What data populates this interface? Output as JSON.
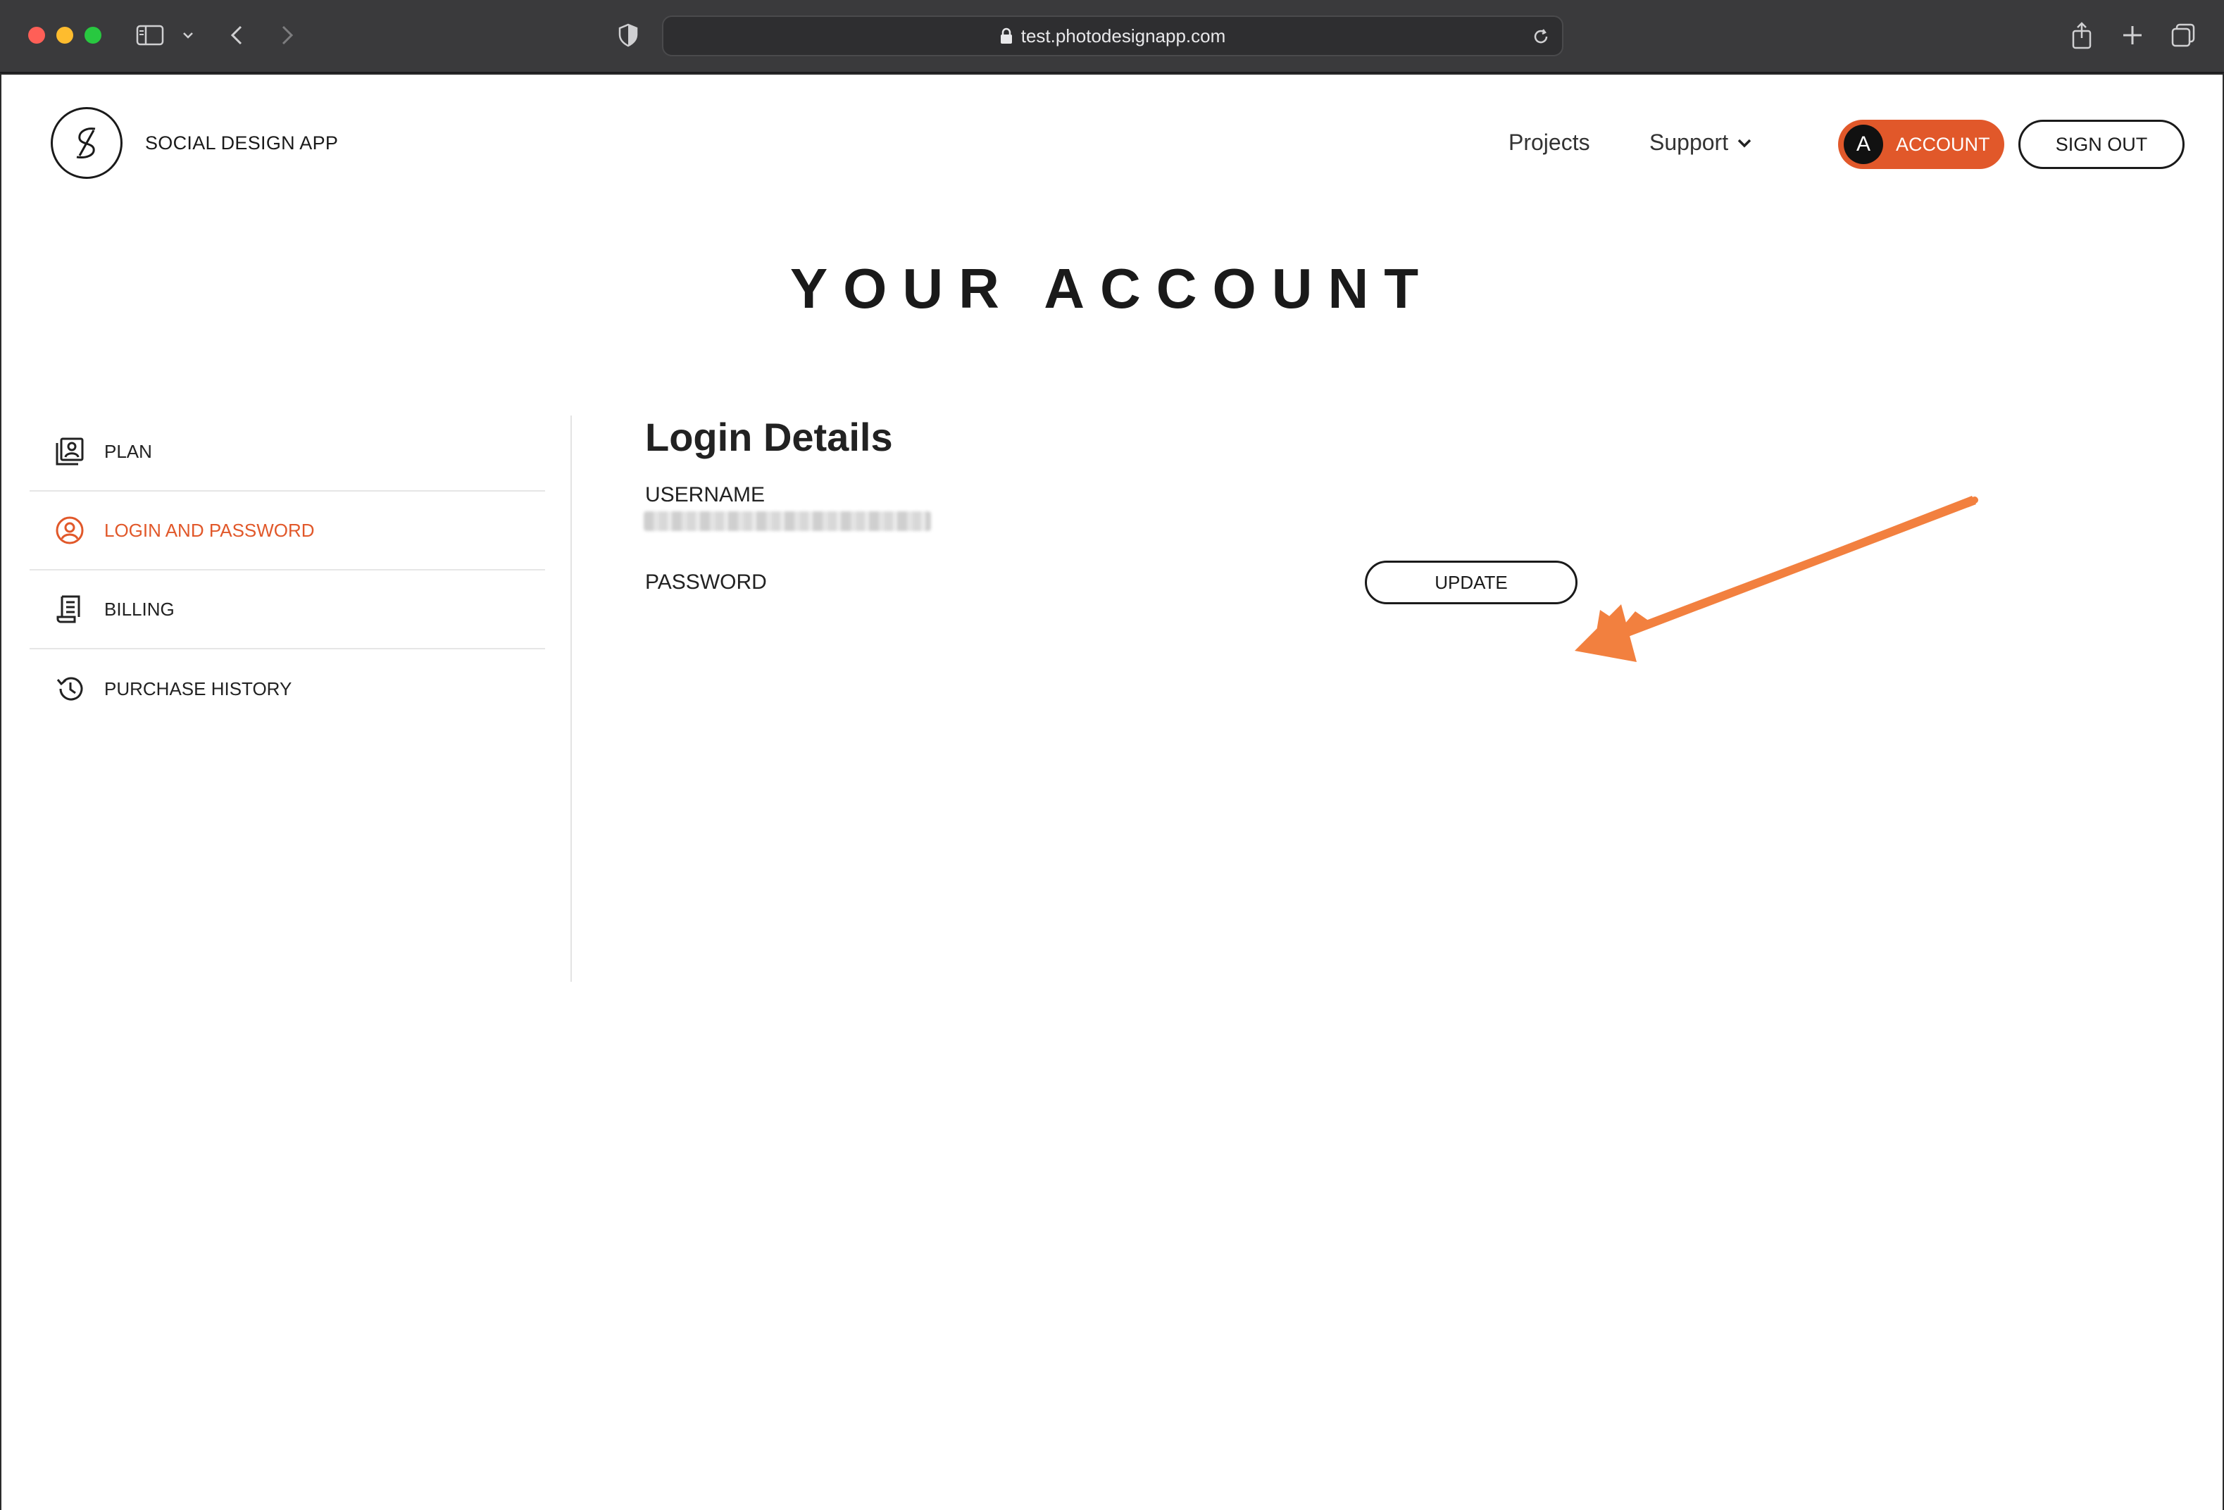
{
  "browser": {
    "url": "test.photodesignapp.com"
  },
  "header": {
    "brand": "SOCIAL DESIGN APP",
    "nav": {
      "projects": "Projects",
      "support": "Support"
    },
    "account": {
      "avatar_letter": "A",
      "label": "ACCOUNT"
    },
    "sign_out": "SIGN OUT"
  },
  "page": {
    "title": "YOUR ACCOUNT"
  },
  "sidebar": {
    "items": [
      {
        "label": "PLAN",
        "icon": "plan-icon",
        "active": false
      },
      {
        "label": "LOGIN AND PASSWORD",
        "icon": "user-circle-icon",
        "active": true
      },
      {
        "label": "BILLING",
        "icon": "receipt-icon",
        "active": false
      },
      {
        "label": "PURCHASE HISTORY",
        "icon": "history-icon",
        "active": false
      }
    ]
  },
  "login_details": {
    "title": "Login Details",
    "username_label": "USERNAME",
    "username_value": "",
    "password_label": "PASSWORD",
    "update_label": "UPDATE"
  },
  "colors": {
    "accent": "#e1582a",
    "annotation_arrow": "#f2803f",
    "text": "#1a1a1a"
  }
}
